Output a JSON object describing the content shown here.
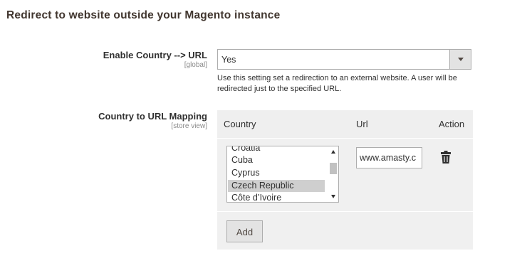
{
  "section": {
    "title": "Redirect to website outside your Magento instance"
  },
  "enable_field": {
    "label": "Enable Country --> URL",
    "scope": "[global]",
    "value": "Yes",
    "hint": "Use this setting set a redirection to an external website. A user will be redirected just to the specified URL."
  },
  "mapping_field": {
    "label": "Country to URL Mapping",
    "scope": "[store view]",
    "headers": {
      "country": "Country",
      "url": "Url",
      "action": "Action"
    },
    "countries": [
      "Croatia",
      "Cuba",
      "Cyprus",
      "Czech Republic",
      "Côte d’Ivoire"
    ],
    "selected_country": "Czech Republic",
    "url_value": "www.amasty.c",
    "add_label": "Add"
  },
  "icons": {
    "select_arrow": "chevron-down-icon",
    "delete": "trash-icon"
  },
  "colors": {
    "grid_bg": "#f0f0f0",
    "selected_option": "#cfcfcf",
    "button_bg": "#e3e3e3",
    "text": "#303030"
  }
}
